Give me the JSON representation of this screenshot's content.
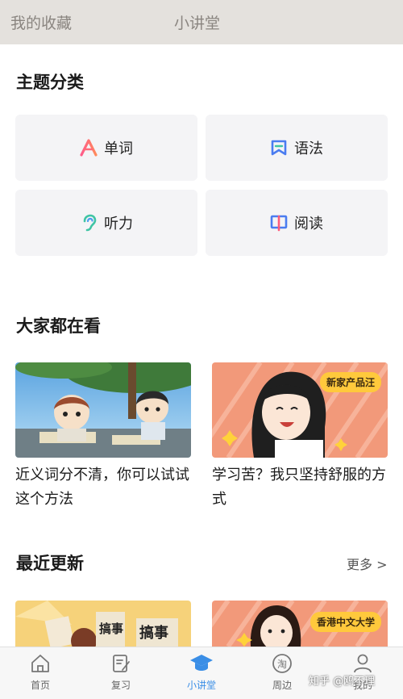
{
  "topbar": {
    "left_tab": "我的收藏",
    "center_tab": "小讲堂"
  },
  "categories": {
    "title": "主题分类",
    "items": [
      {
        "label": "单词",
        "icon": "letter-a-icon"
      },
      {
        "label": "语法",
        "icon": "bookmark-flag-icon"
      },
      {
        "label": "听力",
        "icon": "ear-icon"
      },
      {
        "label": "阅读",
        "icon": "open-book-icon"
      }
    ]
  },
  "popular": {
    "title": "大家都在看",
    "items": [
      {
        "caption": "近义词分不清，你可以试试这个方法"
      },
      {
        "caption": "学习苦？我只坚持舒服的方式",
        "tag": "新家产品汪"
      }
    ]
  },
  "recent": {
    "title": "最近更新",
    "more": "更多 >",
    "items": [
      {
        "banner_text": "搞事"
      },
      {
        "tag": "香港中文大学"
      }
    ]
  },
  "bottom_nav": {
    "items": [
      {
        "label": "首页",
        "icon": "home-icon"
      },
      {
        "label": "复习",
        "icon": "notepad-pen-icon"
      },
      {
        "label": "小讲堂",
        "icon": "graduation-cap-icon",
        "active": true
      },
      {
        "label": "周边",
        "icon": "tao-store-icon",
        "glyph": "淘"
      },
      {
        "label": "我的",
        "icon": "profile-icon"
      }
    ]
  },
  "watermark": "知乎 @鸥不理",
  "colors": {
    "accent": "#3a8ee6",
    "topbar_bg": "#e4e1dd",
    "card_bg": "#f4f4f6",
    "tag_yellow": "#ffc93c",
    "orange_thumb": "#f2997a"
  }
}
